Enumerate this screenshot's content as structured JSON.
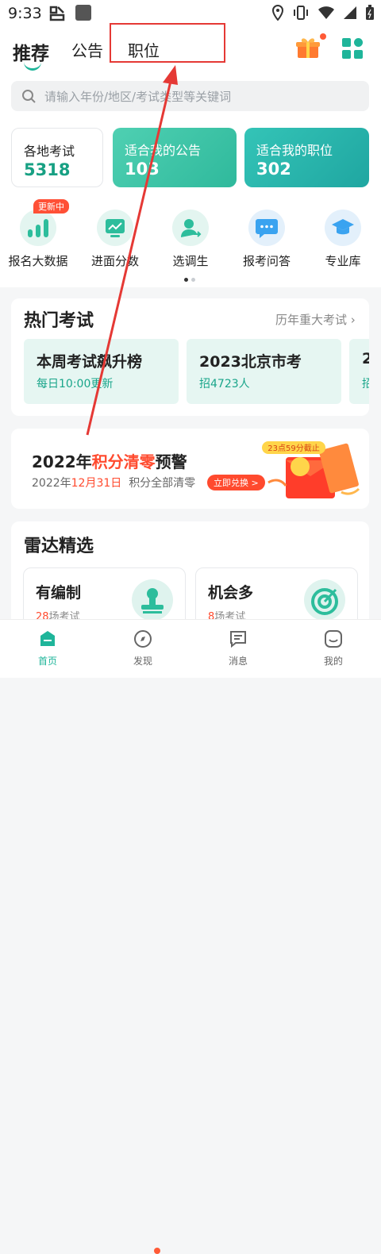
{
  "status_bar": {
    "time": "9:33"
  },
  "top_nav": {
    "tabs": [
      {
        "label": "推荐"
      },
      {
        "label": "公告"
      },
      {
        "label": "职位"
      }
    ]
  },
  "search": {
    "placeholder": "请输入年份/地区/考试类型等关键词"
  },
  "stats": [
    {
      "title": "各地考试",
      "value": "5318"
    },
    {
      "title": "适合我的公告",
      "value": "103"
    },
    {
      "title": "适合我的职位",
      "value": "302"
    }
  ],
  "quick_links": [
    {
      "label": "报名大数据",
      "badge": "更新中",
      "icon": "bar-chart-icon"
    },
    {
      "label": "进面分数",
      "icon": "trend-chart-icon"
    },
    {
      "label": "选调生",
      "icon": "user-transfer-icon"
    },
    {
      "label": "报考问答",
      "icon": "chat-bubble-icon"
    },
    {
      "label": "专业库",
      "icon": "graduation-cap-icon"
    }
  ],
  "hot_exams": {
    "title": "热门考试",
    "more": "历年重大考试",
    "items": [
      {
        "name": "本周考试飙升榜",
        "sub": "每日10:00更新"
      },
      {
        "name": "2023北京市考",
        "sub": "招4723人"
      },
      {
        "name": "2",
        "sub": "招"
      }
    ]
  },
  "promo": {
    "title_year": "2022年",
    "title_highlight": "积分清零",
    "title_end": "预警",
    "sub_prefix": "2022年",
    "sub_date": "12月31日",
    "sub_suffix": "积分全部清零",
    "button": "立即兑换 >",
    "deadline": "23点59分截止"
  },
  "radar": {
    "title": "雷达精选",
    "cards": [
      {
        "name": "有编制",
        "count": "28",
        "unit": "场考试",
        "icon": "stamp-icon"
      },
      {
        "name": "机会多",
        "count": "8",
        "unit": "场考试",
        "icon": "target-icon"
      }
    ]
  },
  "bottom_nav": [
    {
      "label": "首页",
      "icon": "home-icon"
    },
    {
      "label": "发现",
      "icon": "compass-icon"
    },
    {
      "label": "消息",
      "icon": "message-icon"
    },
    {
      "label": "我的",
      "icon": "profile-icon"
    }
  ],
  "colors": {
    "accent": "#1fb59a",
    "red": "#ff4a2e",
    "annotation": "#e53935"
  }
}
